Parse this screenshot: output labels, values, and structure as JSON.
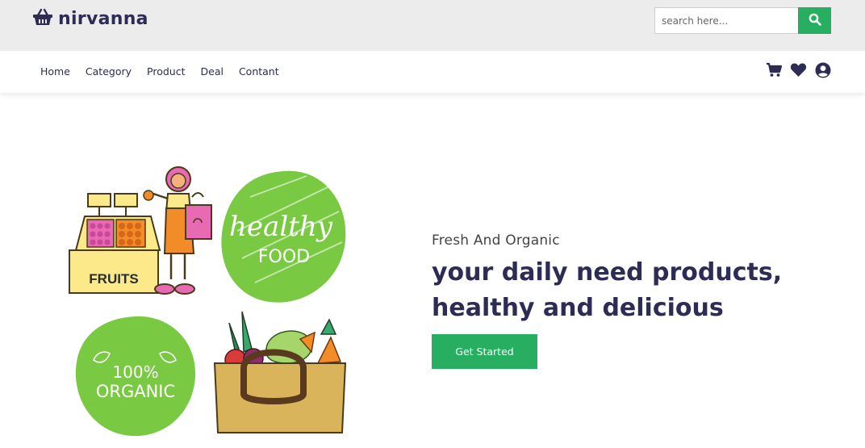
{
  "brand": {
    "name": "nirvanna",
    "icon": "basket-icon"
  },
  "search": {
    "placeholder": "search here...",
    "value": "",
    "button_icon": "search-icon"
  },
  "nav": {
    "links": [
      "Home",
      "Category",
      "Product",
      "Deal",
      "Contant"
    ],
    "icons": [
      "cart-icon",
      "heart-icon",
      "user-icon"
    ]
  },
  "illustration": {
    "fruits_label": "FRUITS",
    "healthy_food_line1": "healthy",
    "healthy_food_line2": "FOOD",
    "organic_line1": "100%",
    "organic_line2": "ORGANIC"
  },
  "hero": {
    "subtitle": "Fresh And Organic",
    "headline": "your daily need products, healthy and delicious",
    "cta_label": "Get Started"
  },
  "colors": {
    "accent": "#27ae60",
    "text_dark": "#2c2c54",
    "topbar_bg": "#ececec",
    "lime": "#7ac943"
  }
}
